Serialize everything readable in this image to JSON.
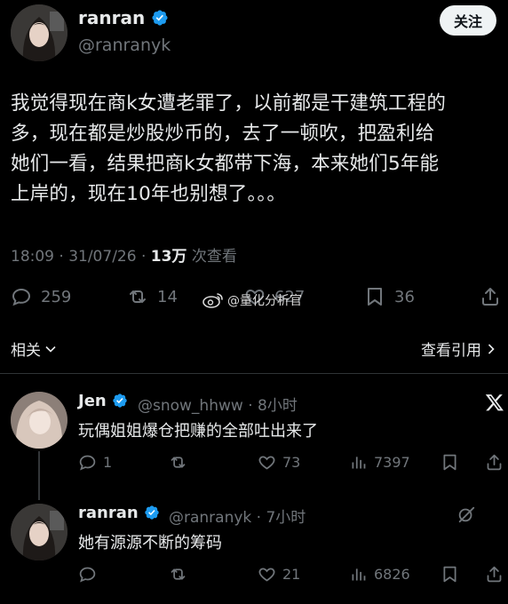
{
  "main_tweet": {
    "author": {
      "name": "ranran",
      "handle": "@ranranyk",
      "verified": true
    },
    "follow_label": "关注",
    "text_lines": [
      "我觉得现在商k女遭老罪了，以前都是干建筑工程的",
      "多，现在都是炒股炒币的，去了一顿吹，把盈利给",
      "她们一看，结果把商k女都带下海，本来她们5年能",
      "上岸的，现在10年也别想了。。。"
    ],
    "meta": {
      "time_date": "18:09 · 31/07/26 · ",
      "views": "13万",
      "views_label": " 次查看"
    },
    "stats": {
      "replies": "259",
      "retweets": "14",
      "likes": "627",
      "bookmarks": "36"
    }
  },
  "watermark": "@量化分析官",
  "related_label": "相关",
  "quotes_label": "查看引用",
  "replies": [
    {
      "name": "Jen",
      "handle": "@snow_hhww · 8小时",
      "text": "玩偶姐姐爆仓把赚的全部吐出来了",
      "stats": {
        "replies": "1",
        "retweets": "",
        "likes": "73",
        "views": "7397"
      },
      "source_icon": "x-logo-icon"
    },
    {
      "name": "ranran",
      "handle": "@ranranyk · 7小时",
      "text": "她有源源不断的筹码",
      "stats": {
        "replies": "",
        "retweets": "",
        "likes": "21",
        "views": "6826"
      },
      "source_icon": "grok-icon"
    }
  ],
  "colors": {
    "background": "#000000",
    "text": "#e7e9ea",
    "muted": "#71767b",
    "verified": "#1d9bf0"
  }
}
